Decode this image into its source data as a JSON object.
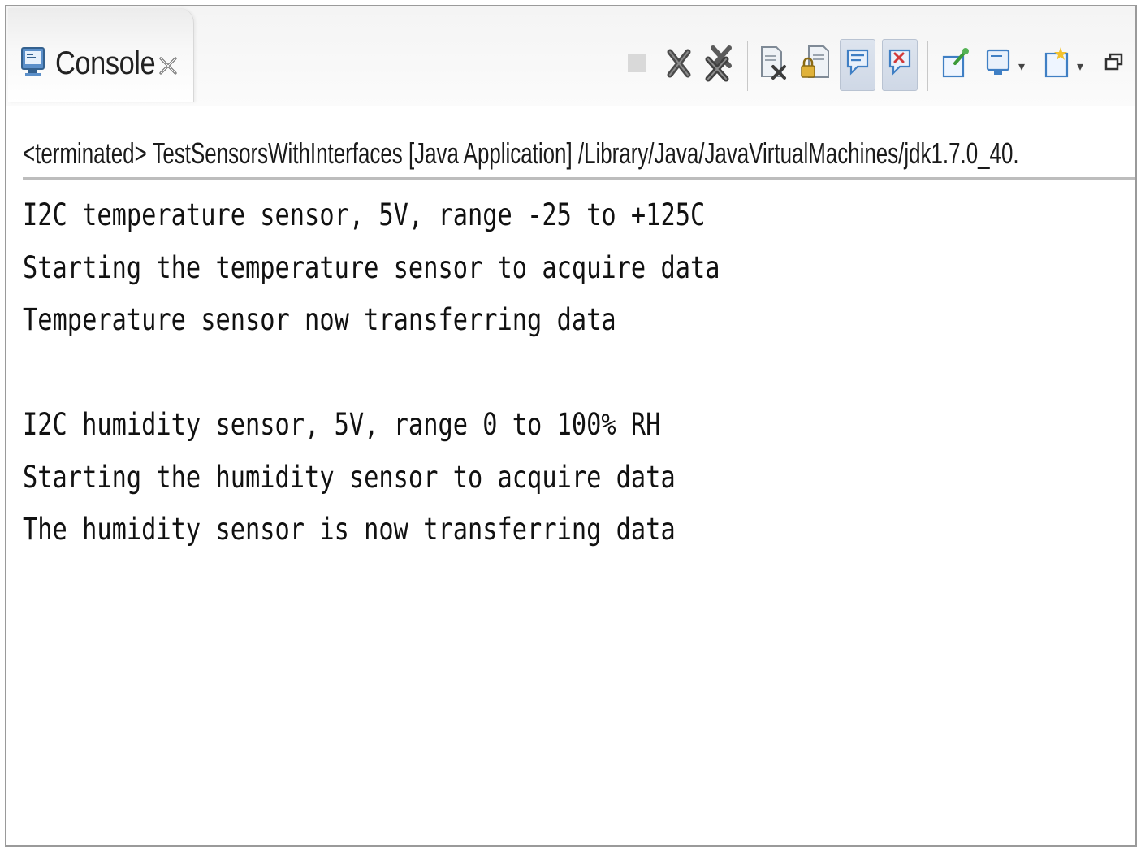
{
  "console_tab": {
    "label": "Console",
    "icon": "console-monitor-icon",
    "close_icon": "close-tab-icon"
  },
  "toolbar": {
    "buttons": [
      {
        "name": "terminate-icon",
        "enabled": false
      },
      {
        "name": "remove-launch-icon",
        "enabled": true
      },
      {
        "name": "remove-all-terminated-icon",
        "enabled": true
      },
      {
        "name": "clear-console-icon",
        "enabled": true
      },
      {
        "name": "scroll-lock-icon",
        "enabled": true
      },
      {
        "name": "show-console-on-stdout-icon",
        "enabled": true,
        "pressed": true
      },
      {
        "name": "show-console-on-stderr-icon",
        "enabled": true,
        "pressed": true
      },
      {
        "name": "pin-console-icon",
        "enabled": true
      },
      {
        "name": "display-selected-console-icon",
        "enabled": true
      },
      {
        "name": "open-console-icon",
        "enabled": true
      },
      {
        "name": "minimize-view-icon",
        "enabled": true
      }
    ]
  },
  "process_label": "<terminated> TestSensorsWithInterfaces [Java Application] /Library/Java/JavaVirtualMachines/jdk1.7.0_40.",
  "output": {
    "lines": [
      "I2C temperature sensor, 5V, range -25 to +125C",
      "Starting the temperature sensor to acquire data",
      "Temperature sensor now transferring data",
      "",
      "I2C humidity sensor, 5V, range 0 to 100% RH",
      "Starting the humidity sensor to acquire data",
      "The humidity sensor is now transferring data"
    ]
  },
  "colors": {
    "border": "#9a9a9a",
    "text": "#111111",
    "pressed_bg": "#cfd8e6",
    "accent_blue": "#3f7fc4"
  }
}
